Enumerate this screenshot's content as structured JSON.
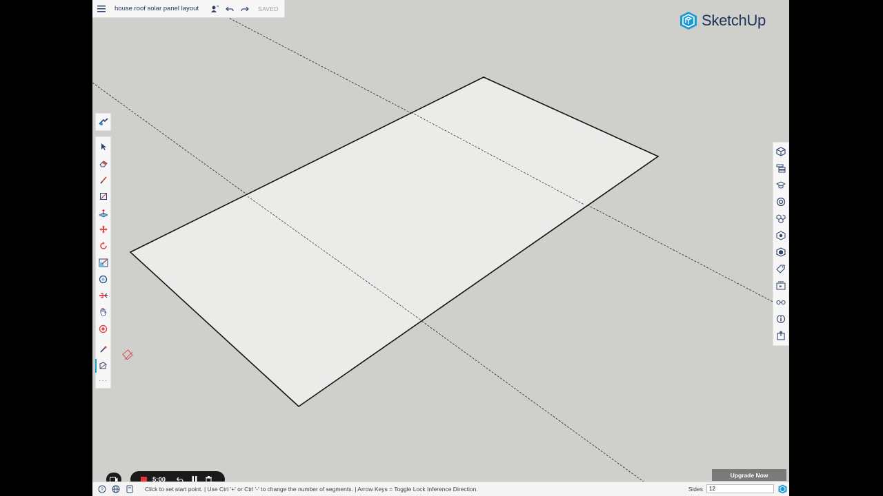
{
  "header": {
    "title": "house roof solar panel layout",
    "status": "SAVED"
  },
  "logo": {
    "text": "SketchUp",
    "color": "#1f3356"
  },
  "left_toolbar": {
    "top_tool": "search-tool-icon",
    "tools": [
      "select-icon",
      "eraser-icon",
      "pencil-icon",
      "rectangle-icon",
      "push-pull-icon",
      "move-icon",
      "rotate-icon",
      "scale-icon",
      "tape-measure-icon",
      "section-plane-icon",
      "pan-icon",
      "orbit-icon",
      "eyedropper-icon",
      "polygon-icon"
    ],
    "active_tool": "polygon-icon",
    "more_label": "···"
  },
  "right_toolbar": {
    "items": [
      "entity-info-icon",
      "outliner-icon",
      "instructor-icon",
      "styles-icon",
      "components-icon",
      "materials-icon",
      "3d-warehouse-icon",
      "tags-icon",
      "scenes-icon",
      "display-icon",
      "info-icon",
      "export-icon"
    ]
  },
  "recorder": {
    "time": "5:00"
  },
  "status_bar": {
    "hint": "Click to set start point. | Use Ctrl '+' or Ctrl '-' to change the number of segments. | Arrow Keys = Toggle Lock Inference Direction.",
    "sides_label": "Sides",
    "sides_value": "12"
  },
  "upgrade_button": {
    "label": "Upgrade Now"
  },
  "colors": {
    "canvas": "#cfcfcb",
    "face": "#ebebe9",
    "accent": "#1c9ad6",
    "record": "#e53935"
  }
}
